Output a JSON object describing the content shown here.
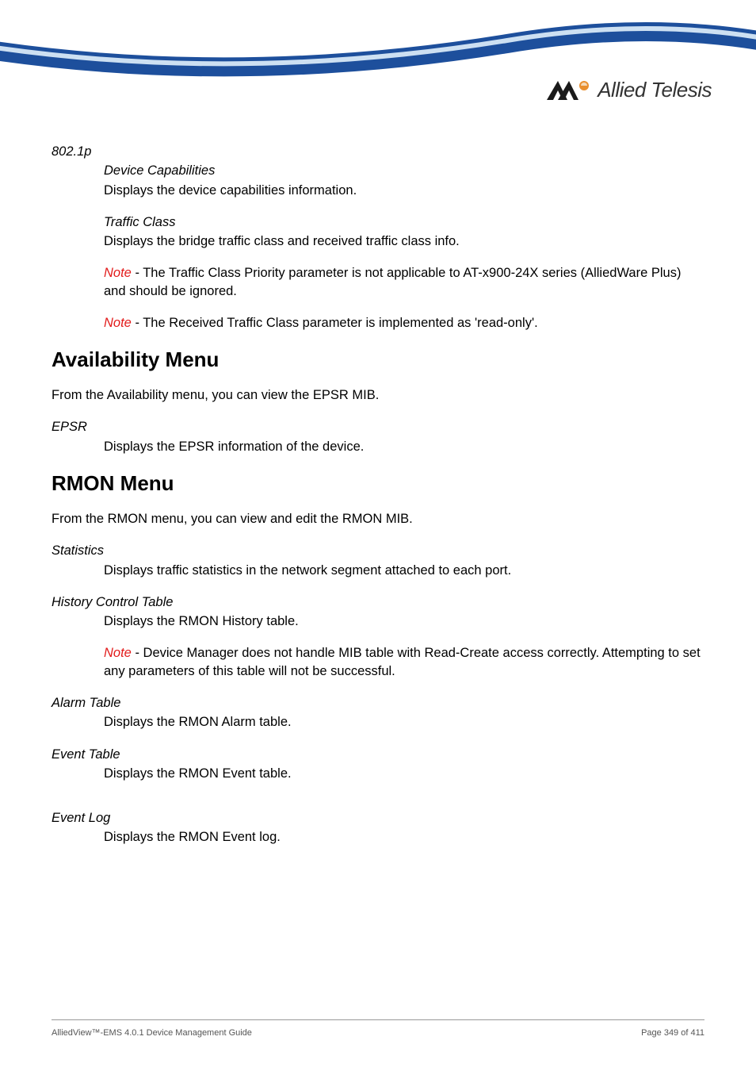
{
  "brand": {
    "name": "Allied Telesis"
  },
  "sections": {
    "s8021p": {
      "title": "802.1p",
      "devcap_label": "Device Capabilities",
      "devcap_text": "Displays the device capabilities information.",
      "traffic_label": "Traffic Class",
      "traffic_text": "Displays the bridge traffic class and received traffic class info.",
      "note1_kw": "Note",
      "note1_text": " - The Traffic Class Priority parameter is not applicable to AT-x900-24X series (AlliedWare Plus) and should be ignored.",
      "note2_kw": "Note",
      "note2_text": " - The Received Traffic Class parameter is implemented as 'read-only'."
    },
    "avail": {
      "heading": "Availability Menu",
      "intro": "From the Availability menu, you can view the EPSR MIB.",
      "epsr_label": "EPSR",
      "epsr_text": "Displays the EPSR information of the device."
    },
    "rmon": {
      "heading": "RMON Menu",
      "intro": "From the RMON menu, you can view and edit the RMON MIB.",
      "stats_label": "Statistics",
      "stats_text": "Displays traffic statistics in the network segment attached to each port.",
      "hist_label": "History Control Table",
      "hist_text": "Displays the RMON History table.",
      "hist_note_kw": "Note",
      "hist_note_text": " - Device Manager does not handle MIB table with Read-Create access correctly. Attempting to set any parameters of this table will not be successful.",
      "alarm_label": "Alarm Table",
      "alarm_text": "Displays the RMON Alarm table.",
      "event_label": "Event Table",
      "event_text": "Displays the RMON Event table.",
      "eventlog_label": "Event Log",
      "eventlog_text": "Displays the RMON Event log."
    }
  },
  "footer": {
    "left": "AlliedView™-EMS 4.0.1 Device Management Guide",
    "right": "Page 349 of 411"
  }
}
